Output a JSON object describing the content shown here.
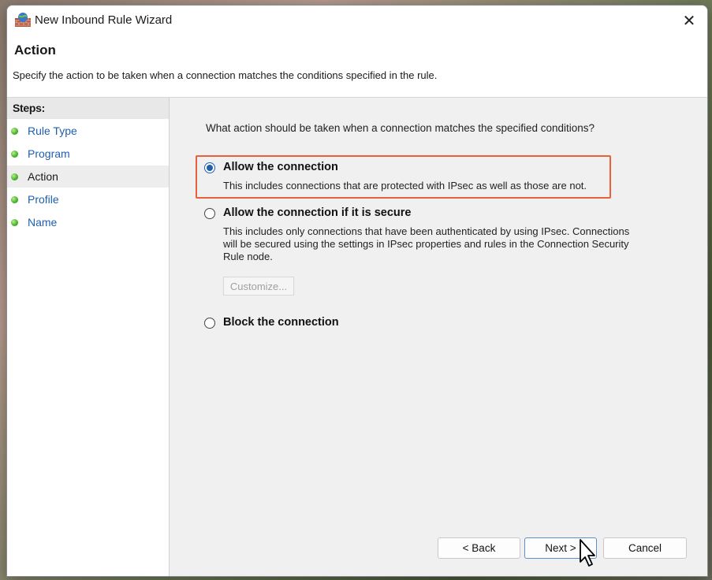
{
  "window": {
    "title": "New Inbound Rule Wizard",
    "close_glyph": "✕",
    "icon": "firewall-icon"
  },
  "header": {
    "title": "Action",
    "description": "Specify the action to be taken when a connection matches the conditions specified in the rule."
  },
  "sidebar": {
    "heading": "Steps:",
    "items": [
      {
        "label": "Rule Type",
        "current": false
      },
      {
        "label": "Program",
        "current": false
      },
      {
        "label": "Action",
        "current": true
      },
      {
        "label": "Profile",
        "current": false
      },
      {
        "label": "Name",
        "current": false
      }
    ]
  },
  "main": {
    "question": "What action should be taken when a connection matches the specified conditions?",
    "options": [
      {
        "label": "Allow the connection",
        "description": "This includes connections that are protected with IPsec as well as those are not.",
        "selected": true
      },
      {
        "label": "Allow the connection if it is secure",
        "description_lines": [
          "This includes only connections that have been authenticated by using IPsec.  Connections",
          "will be secured using the settings in IPsec properties and rules in the Connection Security",
          "Rule node."
        ],
        "selected": false
      },
      {
        "label": "Block the connection",
        "selected": false
      }
    ],
    "customize_label": "Customize...",
    "highlight_color": "#e8613a"
  },
  "buttons": {
    "back": "< Back",
    "next": "Next >",
    "cancel": "Cancel"
  },
  "colors": {
    "link": "#1f5fae",
    "accent": "#1f5fae"
  }
}
